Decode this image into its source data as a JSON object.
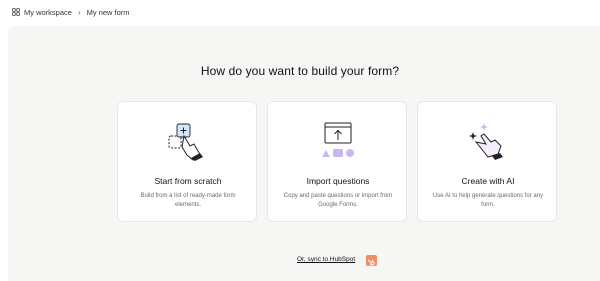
{
  "breadcrumb": {
    "workspace": "My workspace",
    "current": "My new form"
  },
  "heading": "How do you want to build your form?",
  "options": [
    {
      "title": "Start from scratch",
      "description": "Build from a list of ready-made form elements.",
      "icon": "hand-plus-icon"
    },
    {
      "title": "Import questions",
      "description": "Copy and paste questions or import from Google Forms.",
      "icon": "import-window-icon"
    },
    {
      "title": "Create with AI",
      "description": "Use AI to help generate questions for any form.",
      "icon": "sparkle-hand-icon"
    }
  ],
  "sync_link": "Or, sync to HubSpot",
  "colors": {
    "panel": "#f6f6f5",
    "accent_blue": "#cfe6fb",
    "accent_purple": "#c9b8ef",
    "hubspot": "#f08d6d"
  }
}
